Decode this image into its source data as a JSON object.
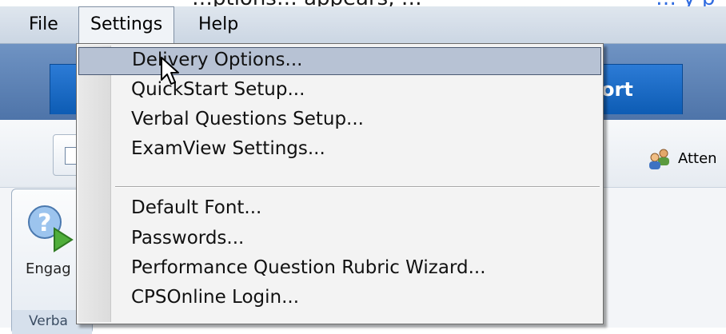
{
  "page_caption": {
    "text": "…ptions… appears, …",
    "link_text": "… y p"
  },
  "menubar": {
    "items": [
      {
        "label": "File"
      },
      {
        "label": "Settings"
      },
      {
        "label": "Help"
      }
    ]
  },
  "app": {
    "tab_label_fragment": "ort",
    "attendance_label": "Atten",
    "engage_label": "Engag",
    "group_label": "Verba"
  },
  "settings_menu": {
    "items": [
      {
        "label": "Delivery Options..."
      },
      {
        "label": "QuickStart Setup..."
      },
      {
        "label": "Verbal Questions Setup..."
      },
      {
        "label": "ExamView Settings..."
      },
      {
        "label": "Default Font..."
      },
      {
        "label": "Passwords..."
      },
      {
        "label": "Performance Question Rubric Wizard..."
      },
      {
        "label": "CPSOnline Login..."
      }
    ],
    "highlighted_index": 0
  },
  "icons": {
    "cursor": "arrow-cursor-icon",
    "question_engage": "question-engage-icon",
    "attendance": "attendance-people-icon"
  },
  "colors": {
    "menu_highlight": "#b7c2d4",
    "tab_blue": "#0d5cb4",
    "caption_link": "#2f6be0"
  }
}
